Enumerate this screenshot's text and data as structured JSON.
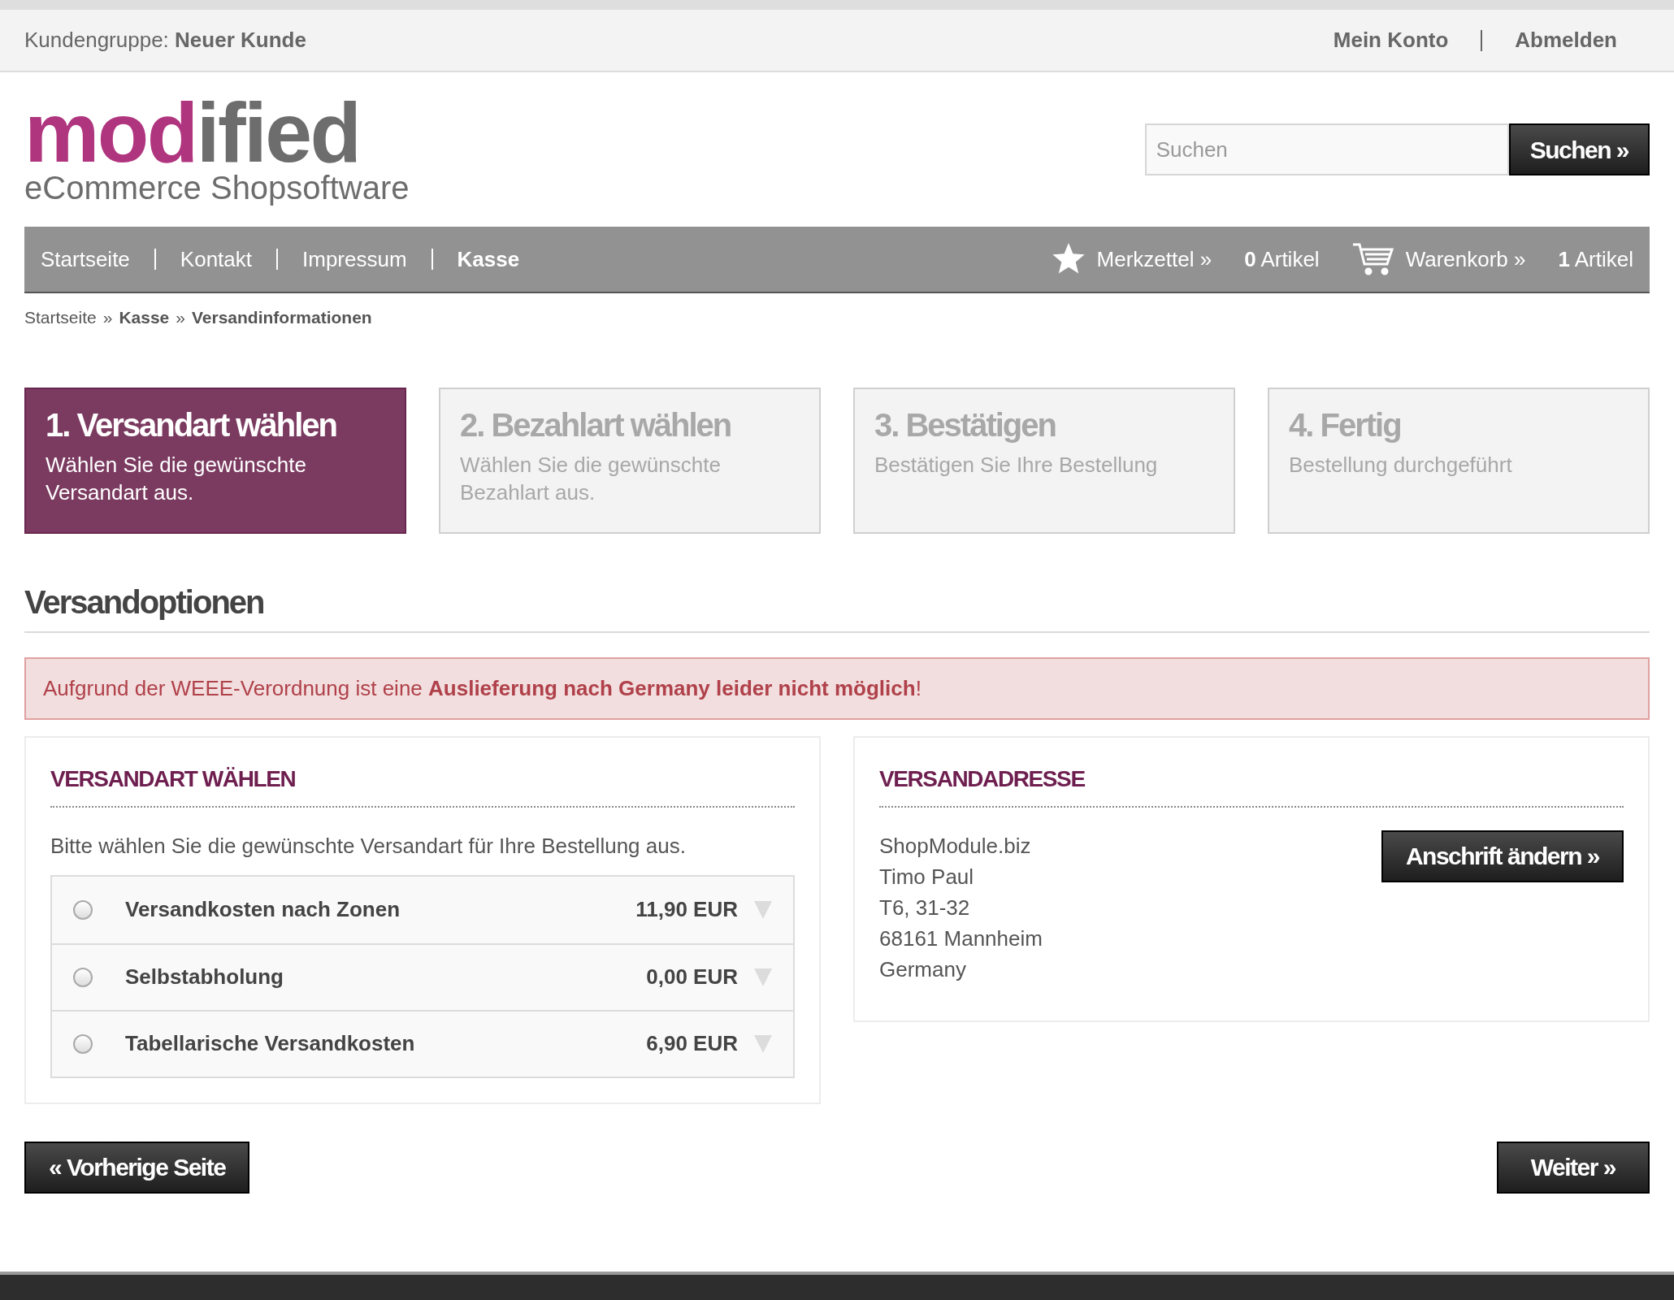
{
  "top_bar": {
    "group_label": "Kundengruppe:",
    "group_value": "Neuer Kunde",
    "links": [
      "Mein Konto",
      "Abmelden"
    ]
  },
  "logo": {
    "part_1": "mod",
    "part_2": "ified",
    "tagline": "eCommerce Shopsoftware"
  },
  "search": {
    "placeholder": "Suchen",
    "button": "Suchen »"
  },
  "nav": {
    "items": [
      {
        "label": "Startseite",
        "selected": false
      },
      {
        "label": "Kontakt",
        "selected": false
      },
      {
        "label": "Impressum",
        "selected": false
      },
      {
        "label": "Kasse",
        "selected": true
      }
    ],
    "wishlist": {
      "label": "Merkzettel »",
      "count": "0",
      "unit": "Artikel"
    },
    "cart": {
      "label": "Warenkorb »",
      "count": "1",
      "unit": "Artikel"
    }
  },
  "breadcrumb": {
    "separator": "»",
    "items": [
      {
        "label": "Startseite",
        "bold": false
      },
      {
        "label": "Kasse",
        "bold": true
      },
      {
        "label": "Versandinformationen",
        "bold": true
      }
    ]
  },
  "steps": [
    {
      "title": "1. Versandart wählen",
      "text": "Wählen Sie die gewünschte Versandart aus.",
      "selected": true
    },
    {
      "title": "2. Bezahlart wählen",
      "text": "Wählen Sie die gewünschte Bezahlart aus.",
      "selected": false
    },
    {
      "title": "3. Bestätigen",
      "text": "Bestätigen Sie Ihre Bestellung",
      "selected": false
    },
    {
      "title": "4. Fertig",
      "text": "Bestellung durchgeführt",
      "selected": false
    }
  ],
  "heading": "Versandoptionen",
  "alert": "Aufgrund der WEEE-Verordnung ist eine **Auslieferung nach Germany leider nicht möglich**!",
  "shipping_panel": {
    "title": "VERSANDART WÄHLEN",
    "intro": "Bitte wählen Sie die gewünschte Versandart für Ihre Bestellung aus.",
    "options": [
      {
        "name": "Versandkosten nach Zonen",
        "price": "11,90 EUR",
        "checked": false
      },
      {
        "name": "Selbstabholung",
        "price": "0,00 EUR",
        "checked": false
      },
      {
        "name": "Tabellarische Versandkosten",
        "price": "6,90 EUR",
        "checked": false
      }
    ]
  },
  "address_panel": {
    "title": "VERSANDADRESSE",
    "lines": [
      "ShopModule.biz",
      "Timo Paul",
      "T6, 31-32",
      "68161 Mannheim",
      "Germany"
    ],
    "button": "Anschrift ändern »"
  },
  "buttons": {
    "back": "« Vorherige Seite",
    "next": "Weiter »"
  }
}
